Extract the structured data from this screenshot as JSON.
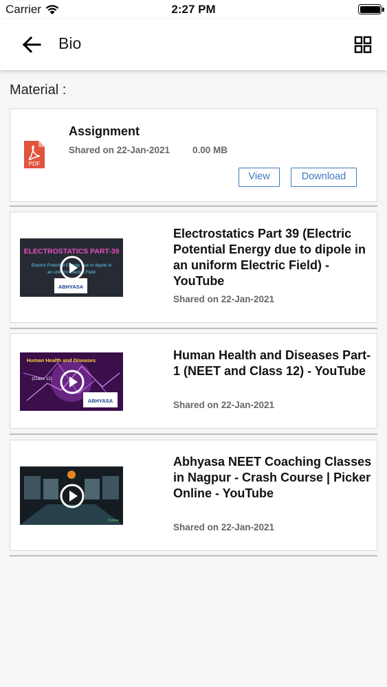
{
  "status_bar": {
    "carrier": "Carrier",
    "time": "2:27 PM"
  },
  "app_bar": {
    "title": "Bio",
    "back_icon": "arrow-left-icon",
    "view_toggle_icon": "grid-icon"
  },
  "section_label": "Material :",
  "document": {
    "title": "Assignment",
    "shared": "Shared on 22-Jan-2021",
    "size": "0.00 MB",
    "icon": "pdf-icon",
    "icon_label": "PDF",
    "view_label": "View",
    "download_label": "Download",
    "accent": "#3b78c2"
  },
  "videos": [
    {
      "title": "Electrostatics Part 39 (Electric Potential Energy due to dipole in an uniform Electric Field) - YouTube",
      "shared": "Shared on 22-Jan-2021",
      "thumb_heading": "ELECTROSTATICS PART-39",
      "thumb_sub1": "Electric Potential Energy due to dipole in",
      "thumb_sub2": "an uniform Electric Field",
      "thumb_brand": "ABHYASA"
    },
    {
      "title": "Human Health and Diseases Part-1 (NEET and Class 12) - YouTube",
      "shared": "Shared on 22-Jan-2021",
      "thumb_heading": "Human Health and Diseases",
      "thumb_sub1": "(Class 12)",
      "thumb_brand": "ABHYASA"
    },
    {
      "title": "Abhyasa NEET Coaching Classes in Nagpur - Crash Course | Picker Online - YouTube",
      "shared": "Shared on 22-Jan-2021",
      "thumb_brand": "Online"
    }
  ]
}
